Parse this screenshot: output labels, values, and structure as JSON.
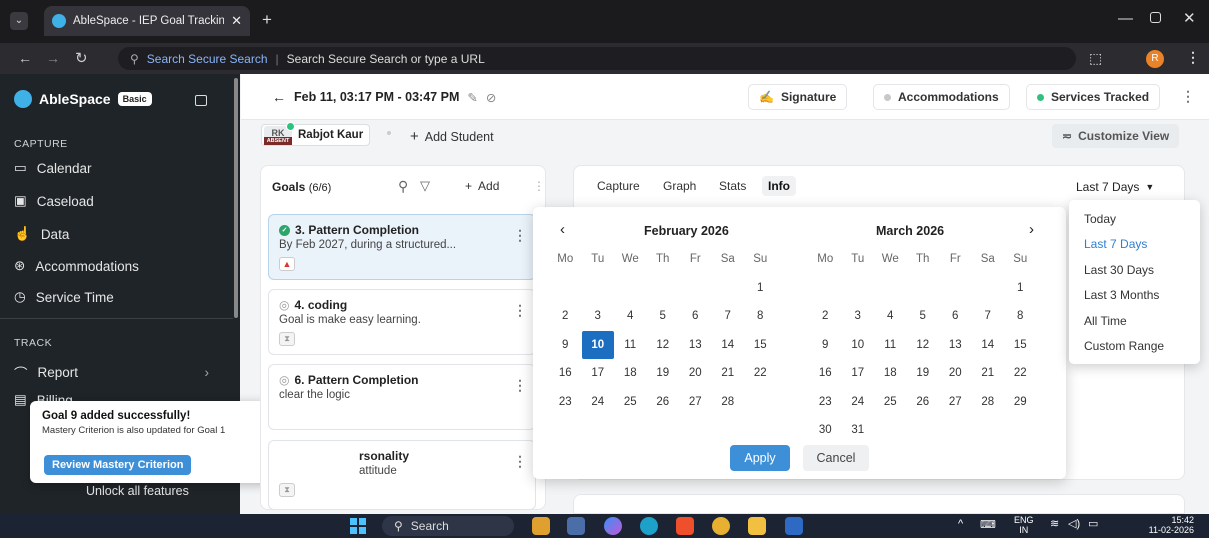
{
  "browser": {
    "tab_title": "AbleSpace - IEP Goal Tracking /",
    "url_prefix": "Search Secure Search",
    "url_placeholder": "Search Secure Search or type a URL",
    "profile_initial": "R"
  },
  "sidebar": {
    "app_name": "AbleSpace",
    "plan_badge": "Basic",
    "capture_header": "CAPTURE",
    "capture_items": [
      {
        "label": "Calendar",
        "icon": "calendar-icon"
      },
      {
        "label": "Caseload",
        "icon": "caseload-icon"
      },
      {
        "label": "Data",
        "icon": "data-icon"
      },
      {
        "label": "Accommodations",
        "icon": "accommodations-icon"
      },
      {
        "label": "Service Time",
        "icon": "clock-icon"
      }
    ],
    "track_header": "TRACK",
    "track_items": [
      {
        "label": "Report",
        "icon": "report-icon"
      },
      {
        "label": "Billing",
        "icon": "billing-icon"
      }
    ],
    "unlock_text": "Unlock all features"
  },
  "toast": {
    "title": "Goal 9 added successfully!",
    "subtitle": "Mastery Criterion is also updated for Goal 1",
    "button": "Review Mastery Criterion"
  },
  "header": {
    "session_time": "Feb 11, 03:17 PM - 03:47 PM",
    "signature": "Signature",
    "accommodations": "Accommodations",
    "services_tracked": "Services Tracked",
    "student_initials": "RK",
    "absent_label": "ABSENT",
    "student_name": "Rabjot Kaur",
    "add_student": "Add Student",
    "customize_view": "Customize View"
  },
  "goals": {
    "title": "Goals",
    "count": "(6/6)",
    "add_label": "Add",
    "items": [
      {
        "title": "3. Pattern Completion",
        "desc": "By Feb 2027, during a structured..."
      },
      {
        "title": "4. coding",
        "desc": "Goal is make easy learning."
      },
      {
        "title": "6. Pattern Completion",
        "desc": "clear the logic"
      },
      {
        "title": "rsonality",
        "desc": "attitude"
      }
    ]
  },
  "tabs": [
    "Capture",
    "Graph",
    "Stats",
    "Info"
  ],
  "active_tab": "Info",
  "date_range": {
    "selected": "Last 7 Days",
    "options": [
      "Today",
      "Last 7 Days",
      "Last 30 Days",
      "Last 3 Months",
      "All Time",
      "Custom Range"
    ]
  },
  "calendar": {
    "weekdays": [
      "Mo",
      "Tu",
      "We",
      "Th",
      "Fr",
      "Sa",
      "Su"
    ],
    "left_month": "February 2026",
    "right_month": "March 2026",
    "left_days": [
      "",
      "",
      "",
      "",
      "",
      "",
      "1",
      "2",
      "3",
      "4",
      "5",
      "6",
      "7",
      "8",
      "9",
      "10",
      "11",
      "12",
      "13",
      "14",
      "15",
      "16",
      "17",
      "18",
      "19",
      "20",
      "21",
      "22",
      "23",
      "24",
      "25",
      "26",
      "27",
      "28",
      ""
    ],
    "right_days": [
      "",
      "",
      "",
      "",
      "",
      "",
      "1",
      "2",
      "3",
      "4",
      "5",
      "6",
      "7",
      "8",
      "9",
      "10",
      "11",
      "12",
      "13",
      "14",
      "15",
      "16",
      "17",
      "18",
      "19",
      "20",
      "21",
      "22",
      "23",
      "24",
      "25",
      "26",
      "27",
      "28",
      "29",
      "30",
      "31",
      "",
      "",
      "",
      "",
      ""
    ],
    "selected_day": "10",
    "apply": "Apply",
    "cancel": "Cancel"
  },
  "taskbar": {
    "search": "Search",
    "lang_top": "ENG",
    "lang_bottom": "IN",
    "time": "15:42",
    "date": "11-02-2026"
  }
}
